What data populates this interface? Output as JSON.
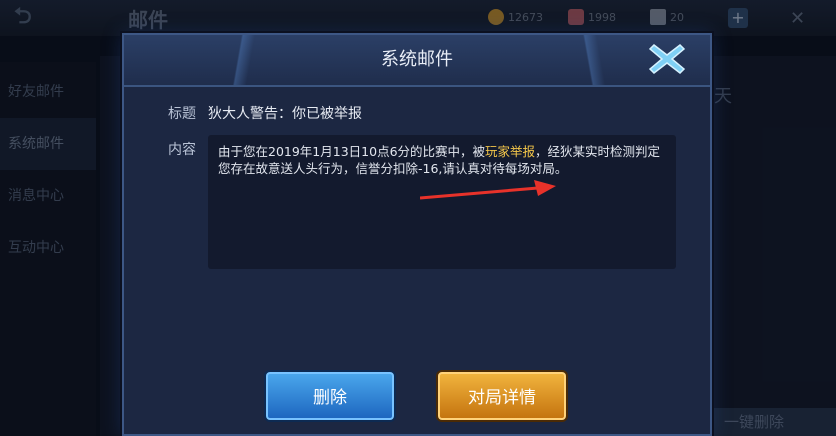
{
  "background": {
    "title": "邮件",
    "resources": [
      {
        "icon": "gold-coin-icon",
        "value": "12673",
        "color": "#d9a441"
      },
      {
        "icon": "gem-icon",
        "value": "1998",
        "color": "#c56b7a"
      },
      {
        "icon": "voucher-icon",
        "value": "20",
        "color": "#9aa7bd"
      }
    ],
    "sidebar": [
      "好友邮件",
      "系统邮件",
      "消息中心",
      "互动中心"
    ],
    "day_text": "天",
    "delete_button": "一键删除"
  },
  "dialog": {
    "title": "系统邮件",
    "subject_label": "标题",
    "subject_value": "狄大人警告：你已被举报",
    "content_label": "内容",
    "content_part1": "由于您在2019年1月13日10点6分的比赛中，被",
    "content_highlight": "玩家举报",
    "content_part2": "，经狄某实时检测判定您存在故意送人头行为，信誉分扣除-16,请认真对待每场对局。",
    "delete_button": "删除",
    "detail_button": "对局详情",
    "highlight_color": "#f3c64a",
    "annotation_color": "#e8322a"
  }
}
